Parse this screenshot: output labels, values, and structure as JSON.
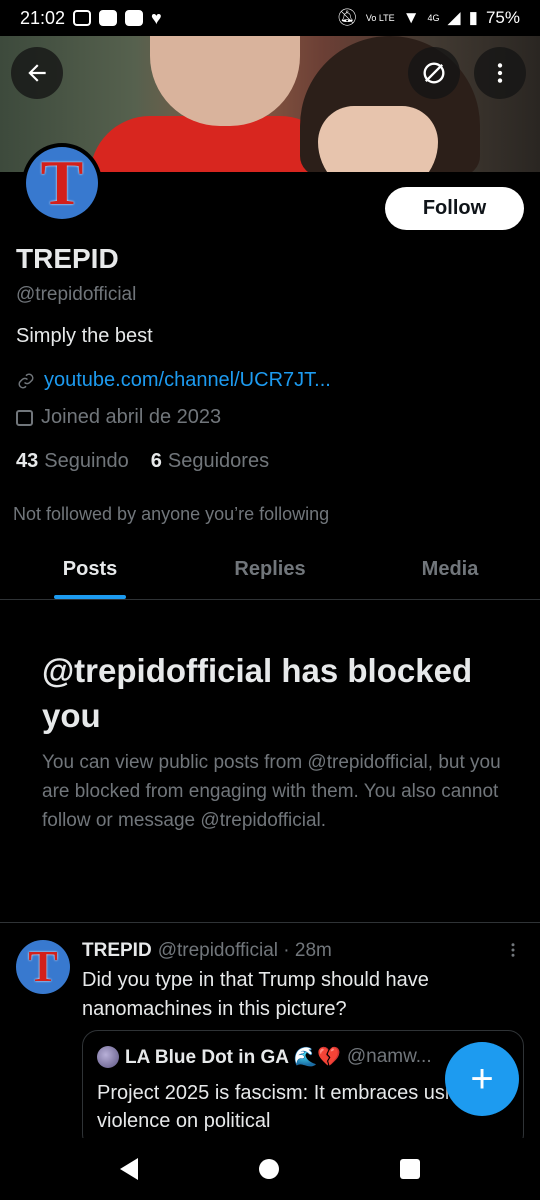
{
  "status_bar": {
    "time": "21:02",
    "network_label": "4G",
    "volte_label": "Vo LTE",
    "battery": "75%"
  },
  "profile": {
    "display_name": "TREPID",
    "handle": "@trepidofficial",
    "bio": "Simply the best",
    "link": "youtube.com/channel/UCR7JT...",
    "joined": "Joined abril de 2023",
    "following_count": "43",
    "following_label": "Seguindo",
    "followers_count": "6",
    "followers_label": "Seguidores",
    "not_followed_note": "Not followed by anyone you’re following",
    "avatar_letter": "T",
    "follow_label": "Follow"
  },
  "tabs": [
    {
      "label": "Posts",
      "active": true
    },
    {
      "label": "Replies",
      "active": false
    },
    {
      "label": "Media",
      "active": false
    }
  ],
  "blocked_notice": {
    "title": "@trepidofficial has blocked you",
    "description": "You can view public posts from @trepidofficial, but you are blocked from engaging with them. You also cannot follow or message @trepidofficial."
  },
  "tweet": {
    "author_name": "TREPID",
    "author_handle": "@trepidofficial",
    "time": "· 28m",
    "text": "Did you type in that Trump should have nanomachines in this picture?",
    "quote": {
      "author_name": "LA Blue Dot in GA 🌊💔",
      "author_handle": "@namw...",
      "text": "Project 2025 is fascism: It embraces using violence on political"
    }
  },
  "icons": {
    "back": "arrow-left-icon",
    "grok": "grok-icon",
    "more": "more-vertical-icon",
    "link": "link-icon",
    "calendar": "calendar-icon",
    "compose": "plus-icon"
  },
  "colors": {
    "accent": "#1d9bf0",
    "background": "#000000",
    "secondary_text": "#71767b"
  },
  "fab_label": "+"
}
